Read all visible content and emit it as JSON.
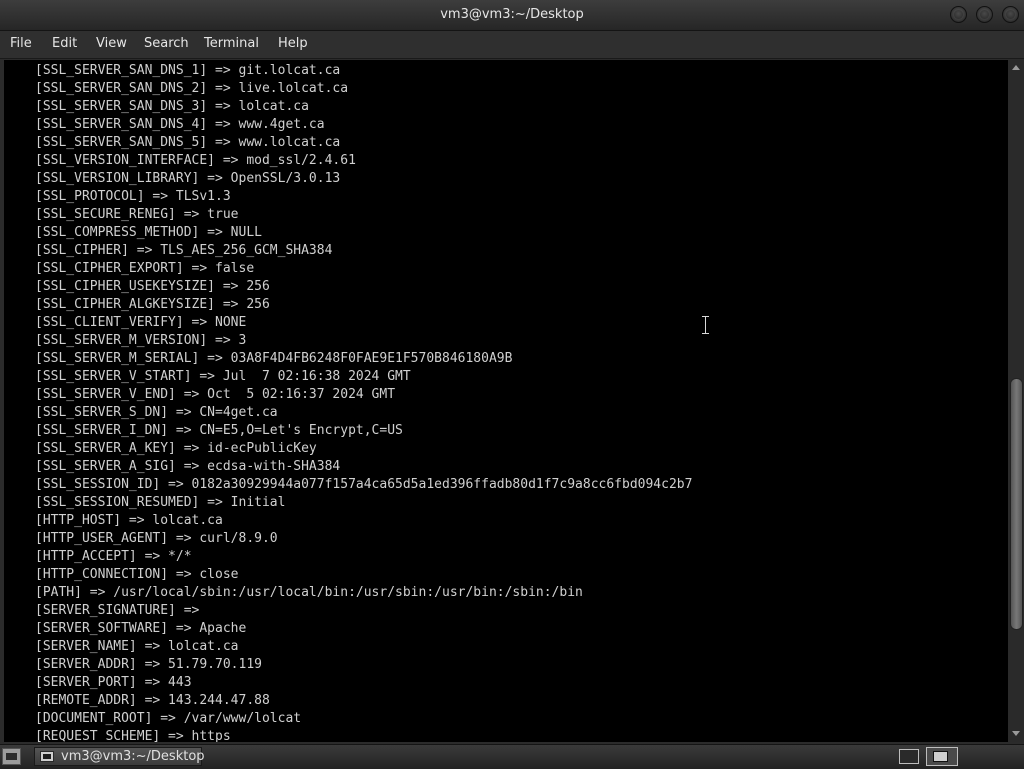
{
  "window": {
    "title": "vm3@vm3:~/Desktop"
  },
  "menu": {
    "file": "File",
    "edit": "Edit",
    "view": "View",
    "search": "Search",
    "terminal": "Terminal",
    "help": "Help"
  },
  "terminal": {
    "lines": [
      "[SSL_SERVER_SAN_DNS_1] => git.lolcat.ca",
      "[SSL_SERVER_SAN_DNS_2] => live.lolcat.ca",
      "[SSL_SERVER_SAN_DNS_3] => lolcat.ca",
      "[SSL_SERVER_SAN_DNS_4] => www.4get.ca",
      "[SSL_SERVER_SAN_DNS_5] => www.lolcat.ca",
      "[SSL_VERSION_INTERFACE] => mod_ssl/2.4.61",
      "[SSL_VERSION_LIBRARY] => OpenSSL/3.0.13",
      "[SSL_PROTOCOL] => TLSv1.3",
      "[SSL_SECURE_RENEG] => true",
      "[SSL_COMPRESS_METHOD] => NULL",
      "[SSL_CIPHER] => TLS_AES_256_GCM_SHA384",
      "[SSL_CIPHER_EXPORT] => false",
      "[SSL_CIPHER_USEKEYSIZE] => 256",
      "[SSL_CIPHER_ALGKEYSIZE] => 256",
      "[SSL_CLIENT_VERIFY] => NONE",
      "[SSL_SERVER_M_VERSION] => 3",
      "[SSL_SERVER_M_SERIAL] => 03A8F4D4FB6248F0FAE9E1F570B846180A9B",
      "[SSL_SERVER_V_START] => Jul  7 02:16:38 2024 GMT",
      "[SSL_SERVER_V_END] => Oct  5 02:16:37 2024 GMT",
      "[SSL_SERVER_S_DN] => CN=4get.ca",
      "[SSL_SERVER_I_DN] => CN=E5,O=Let's Encrypt,C=US",
      "[SSL_SERVER_A_KEY] => id-ecPublicKey",
      "[SSL_SERVER_A_SIG] => ecdsa-with-SHA384",
      "[SSL_SESSION_ID] => 0182a30929944a077f157a4ca65d5a1ed396ffadb80d1f7c9a8cc6fbd094c2b7",
      "[SSL_SESSION_RESUMED] => Initial",
      "[HTTP_HOST] => lolcat.ca",
      "[HTTP_USER_AGENT] => curl/8.9.0",
      "[HTTP_ACCEPT] => */*",
      "[HTTP_CONNECTION] => close",
      "[PATH] => /usr/local/sbin:/usr/local/bin:/usr/sbin:/usr/bin:/sbin:/bin",
      "[SERVER_SIGNATURE] =>",
      "[SERVER_SOFTWARE] => Apache",
      "[SERVER_NAME] => lolcat.ca",
      "[SERVER_ADDR] => 51.79.70.119",
      "[SERVER_PORT] => 443",
      "[REMOTE_ADDR] => 143.244.47.88",
      "[DOCUMENT_ROOT] => /var/www/lolcat",
      "[REQUEST_SCHEME] => https"
    ]
  },
  "taskbar": {
    "task_label": "vm3@vm3:~/Desktop"
  },
  "icons": {
    "window_controls": [
      "minimize-icon",
      "maximize-icon",
      "close-icon"
    ],
    "launcher": "terminal-launcher-icon",
    "task": "terminal-icon",
    "workspaces": [
      "workspace-1-icon",
      "workspace-2-icon"
    ]
  }
}
